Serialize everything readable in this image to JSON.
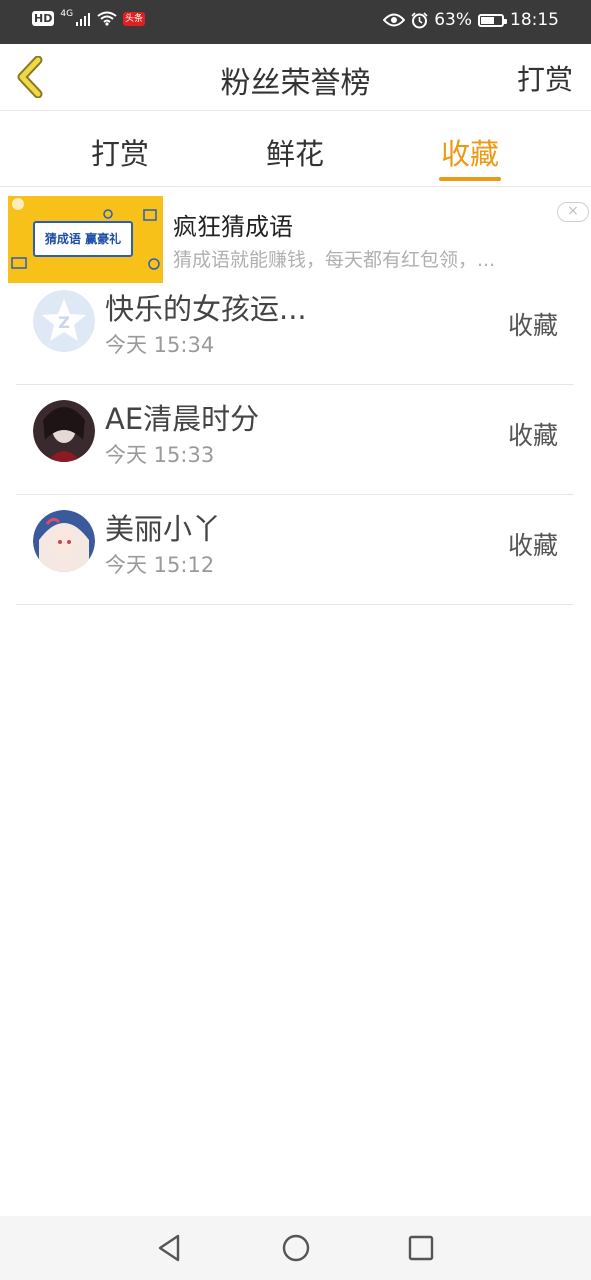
{
  "status_bar": {
    "hd": "HD",
    "network": "4G",
    "app_badge": "头条",
    "battery": "63%",
    "battery_level": 0.63,
    "time": "18:15"
  },
  "header": {
    "title": "粉丝荣誉榜",
    "right_action": "打赏"
  },
  "tabs": [
    {
      "label": "打赏",
      "active": false
    },
    {
      "label": "鲜花",
      "active": false
    },
    {
      "label": "收藏",
      "active": true
    }
  ],
  "ad": {
    "image_text": "猜成语 赢豪礼",
    "title": "疯狂猜成语",
    "description": "猜成语就能赚钱，每天都有红包领，...",
    "close_symbol": "×"
  },
  "list": [
    {
      "name": "快乐的女孩运...",
      "time": "今天 15:34",
      "action": "收藏"
    },
    {
      "name": "AE清晨时分",
      "time": "今天 15:33",
      "action": "收藏"
    },
    {
      "name": "美丽小丫",
      "time": "今天 15:12",
      "action": "收藏"
    }
  ],
  "colors": {
    "accent": "#ec9a14",
    "status_bar": "#3a3a3a"
  },
  "icons": {
    "back": "chevron-left-icon",
    "nav_back": "triangle-back-icon",
    "nav_home": "circle-home-icon",
    "nav_recent": "square-recent-icon"
  }
}
